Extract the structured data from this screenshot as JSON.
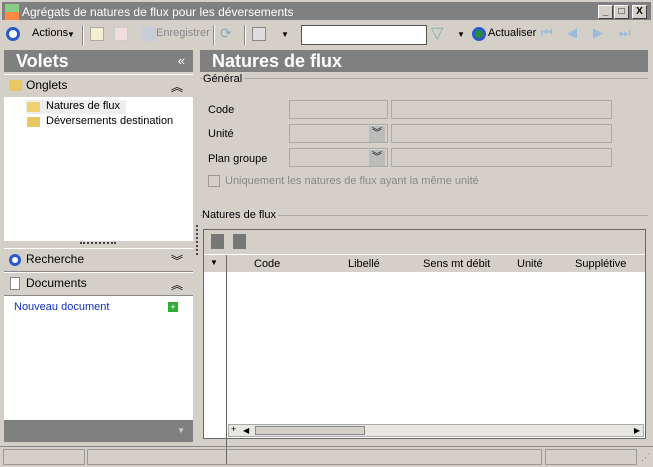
{
  "window": {
    "title": "Agrégats de natures de flux pour les déversements",
    "minimize": "_",
    "maximize": "□",
    "close": "X"
  },
  "toolbar": {
    "actions": "Actions",
    "save": "Enregistrer",
    "search_value": "",
    "refresh": "Actualiser"
  },
  "left": {
    "title": "Volets",
    "collapse": "«",
    "tabs_section": "Onglets",
    "tabs": [
      "Natures de flux",
      "Déversements destination"
    ],
    "search_section": "Recherche",
    "documents_section": "Documents",
    "new_document": "Nouveau document"
  },
  "main": {
    "title": "Natures de flux",
    "general_group": "Général",
    "code_label": "Code",
    "unit_label": "Unité",
    "plan_label": "Plan groupe",
    "checkbox_label": "Uniquement les natures de flux ayant la même unité",
    "checkbox_checked": false,
    "grid_group": "Natures de flux",
    "columns": [
      "Code",
      "Libellé",
      "Sens mt débit",
      "Unité",
      "Supplétive"
    ],
    "rows": []
  }
}
